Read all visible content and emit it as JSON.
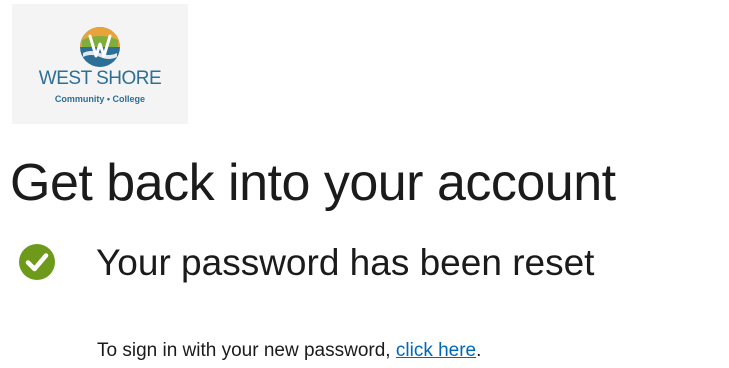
{
  "logo": {
    "line1": "WEST SHORE",
    "line2": "Community • College"
  },
  "title": "Get back into your account",
  "status": {
    "icon": "checkmark-circle-icon",
    "text": "Your password has been reset",
    "icon_color": "#6e9a1c"
  },
  "signin": {
    "prefix": "To sign in with your new password,",
    "link_text": "click here",
    "suffix": ".",
    "link_color": "#0067b8"
  }
}
